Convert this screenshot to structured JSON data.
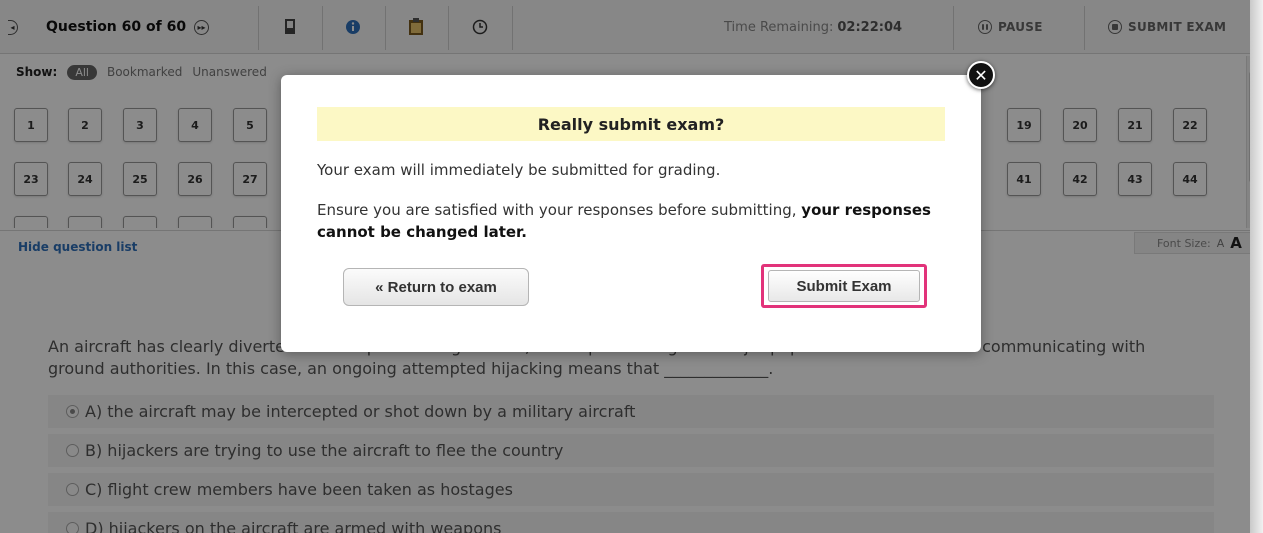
{
  "toolbar": {
    "question_counter": "Question 60 of 60",
    "time_label": "Time Remaining:",
    "time_value": "02:22:04",
    "pause_label": "PAUSE",
    "submit_label": "SUBMIT EXAM"
  },
  "filter": {
    "label": "Show:",
    "options": [
      "All",
      "Bookmarked",
      "Unanswered"
    ]
  },
  "question_grid": {
    "visible_numbers": [
      1,
      2,
      3,
      4,
      5,
      19,
      20,
      21,
      22,
      23,
      24,
      25,
      26,
      27,
      41,
      42,
      43,
      44
    ]
  },
  "hide_question_list": "Hide question list",
  "font_size": {
    "label": "Font Size:",
    "small": "A",
    "large": "A"
  },
  "question": {
    "text": "An aircraft has clearly diverted from its planned flight route, and is proceeding to a major population center without communicating with ground authorities. In this case, an ongoing attempted hijacking means that _____________.",
    "options": [
      {
        "text": "A) the aircraft may be intercepted or shot down by a military aircraft",
        "selected": true
      },
      {
        "text": "B) hijackers are trying to use the aircraft to flee the country",
        "selected": false
      },
      {
        "text": "C) flight crew members have been taken as hostages",
        "selected": false
      },
      {
        "text": "D) hijackers on the aircraft are armed with weapons",
        "selected": false
      }
    ]
  },
  "dialog": {
    "title": "Really submit exam?",
    "message1": "Your exam will immediately be submitted for grading.",
    "message2_plain": "Ensure you are satisfied with your responses before submitting, ",
    "message2_bold": "your responses cannot be changed later.",
    "return_button": "« Return to exam",
    "submit_button": "Submit Exam",
    "close_icon": "close-icon"
  },
  "colors": {
    "dialog_title_bg": "#fcf8c5",
    "highlight": "#e2337a",
    "link": "#2f6fba"
  }
}
